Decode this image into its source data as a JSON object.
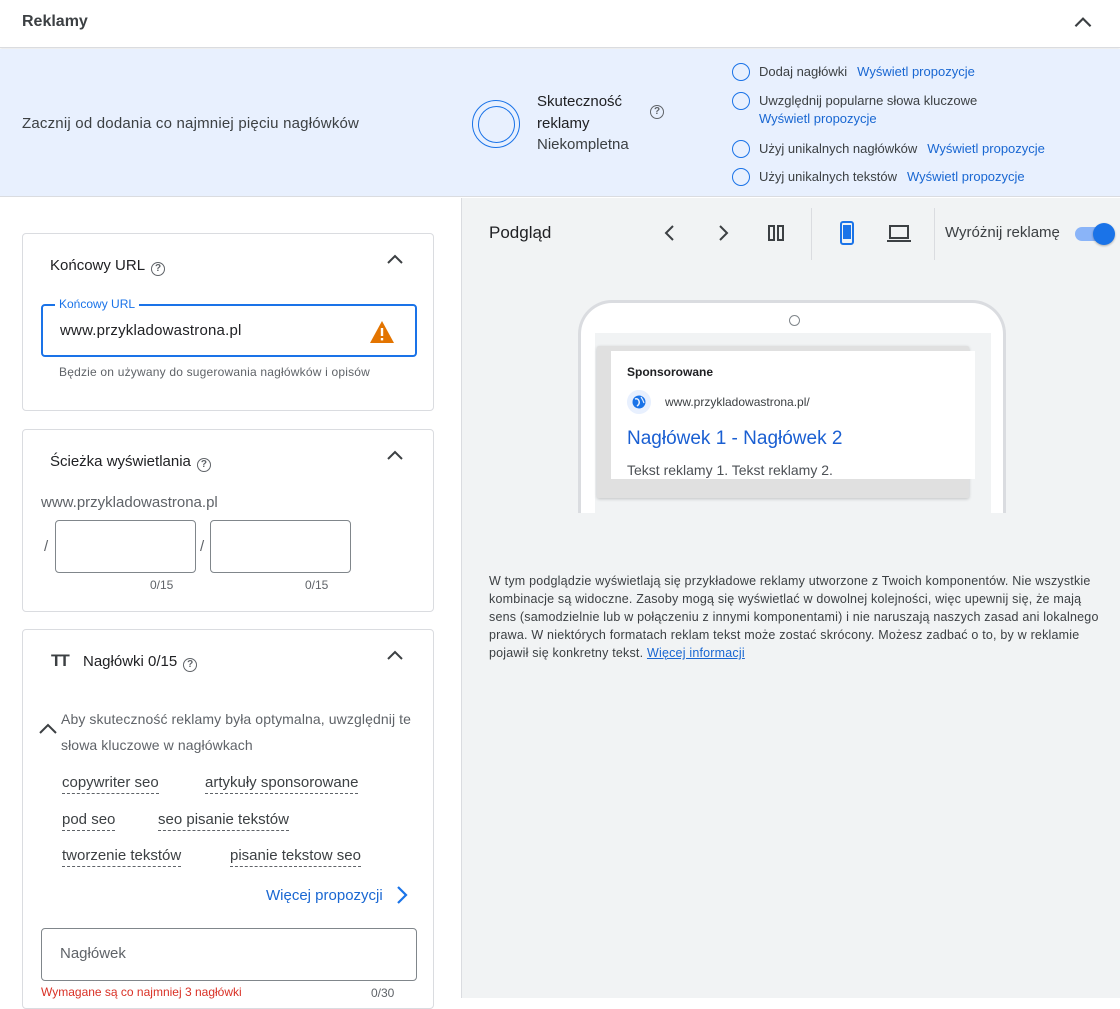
{
  "header": {
    "title": "Reklamy"
  },
  "strength": {
    "intro": "Zacznij od dodania co najmniej pięciu nagłówków",
    "title": "Skuteczność reklamy",
    "status": "Niekompletna",
    "tips": [
      {
        "text": "Dodaj nagłówki",
        "link": "Wyświetl propozycje"
      },
      {
        "text": "Uwzględnij popularne słowa kluczowe",
        "link": "Wyświetl propozycje"
      },
      {
        "text": "Użyj unikalnych nagłówków",
        "link": "Wyświetl propozycje"
      },
      {
        "text": "Użyj unikalnych tekstów",
        "link": "Wyświetl propozycje"
      }
    ]
  },
  "final_url": {
    "title": "Końcowy URL",
    "field_label": "Końcowy URL",
    "value": "www.przykladowastrona.pl",
    "hint": "Będzie on używany do sugerowania nagłówków i opisów"
  },
  "display_path": {
    "title": "Ścieżka wyświetlania",
    "domain": "www.przykladowastrona.pl",
    "slash": "/",
    "counter1": "0/15",
    "counter2": "0/15"
  },
  "headlines": {
    "icon_text": "TT",
    "title": "Nagłówki 0/15",
    "keywords_text": "Aby skuteczność reklamy była optymalna, uwzględnij te słowa kluczowe w nagłówkach",
    "keywords": [
      "copywriter seo",
      "artykuły sponsorowane",
      "pod seo",
      "seo pisanie tekstów",
      "tworzenie tekstów",
      "pisanie tekstow seo"
    ],
    "more_label": "Więcej propozycji",
    "input_placeholder": "Nagłówek",
    "error": "Wymagane są co najmniej 3 nagłówki",
    "counter": "0/30"
  },
  "preview": {
    "title": "Podgląd",
    "highlight_label": "Wyróżnij reklamę",
    "highlight_on": true,
    "device": "mobile",
    "ad": {
      "sponsored": "Sponsorowane",
      "url": "www.przykladowastrona.pl/",
      "headline": "Nagłówek 1 - Nagłówek 2",
      "description": "Tekst reklamy 1. Tekst reklamy 2."
    },
    "disclaimer": "W tym podglądzie wyświetlają się przykładowe reklamy utworzone z Twoich komponentów. Nie wszystkie kombinacje są widoczne. Zasoby mogą się wyświetlać w dowolnej kolejności, więc upewnij się, że mają sens (samodzielnie lub w połączeniu z innymi komponentami) i nie naruszają naszych zasad ani lokalnego prawa. W niektórych formatach reklam tekst może zostać skrócony. Możesz zadbać o to, by w reklamie pojawił się konkretny tekst.",
    "disclaimer_link": "Więcej informacji"
  },
  "colors": {
    "accent": "#1a73e8",
    "panel": "#e8f0fe",
    "error": "#d93025",
    "warning": "#e37400"
  }
}
